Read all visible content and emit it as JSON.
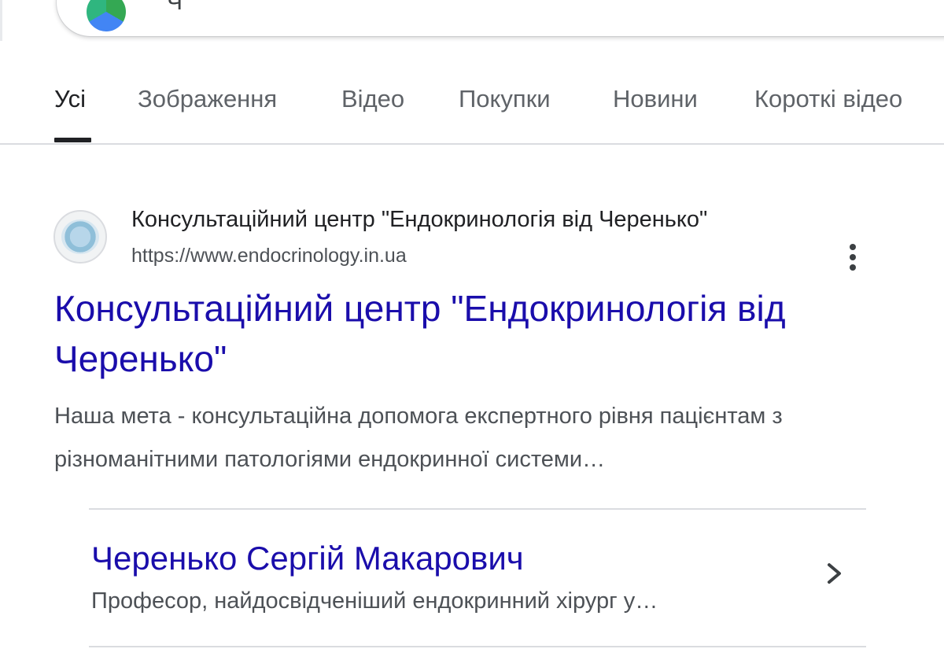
{
  "search": {
    "query": "Ч"
  },
  "tabs": [
    {
      "label": "Усі",
      "active": true
    },
    {
      "label": "Зображення",
      "active": false
    },
    {
      "label": "Відео",
      "active": false
    },
    {
      "label": "Покупки",
      "active": false
    },
    {
      "label": "Новини",
      "active": false
    },
    {
      "label": "Короткі відео",
      "active": false
    }
  ],
  "result": {
    "site_name": "Консультаційний центр \"Ендокринологія від Черенько\"",
    "url": "https://www.endocrinology.in.ua",
    "title": "Консультаційний центр \"Ендокринологія від Черенько\"",
    "snippet": "Наша мета - консультаційна допомога експертного рівня пацієнтам з різноманітними патологіями ендокринної системи…"
  },
  "sitelink": {
    "title": "Черенько Сергій Макарович",
    "description": "Професор, найдосвідченіший ендокринний хірург у…"
  },
  "colors": {
    "link": "#1a0dab",
    "text": "#202124",
    "muted": "#4d5156"
  }
}
